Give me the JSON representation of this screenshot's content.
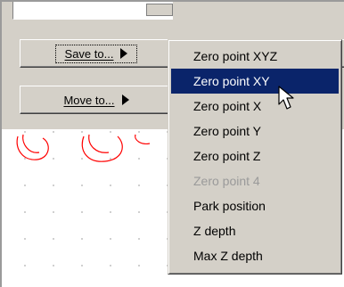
{
  "toolbar": {
    "save_button": {
      "label": "Save to...",
      "icon": "triangle-right-icon"
    },
    "move_button": {
      "label": "Move to...",
      "icon": "triangle-right-icon"
    }
  },
  "context_menu": {
    "items": [
      {
        "label": "Zero point XYZ",
        "state": "normal"
      },
      {
        "label": "Zero point XY",
        "state": "highlighted"
      },
      {
        "label": "Zero point X",
        "state": "normal"
      },
      {
        "label": "Zero point Y",
        "state": "normal"
      },
      {
        "label": "Zero point Z",
        "state": "normal"
      },
      {
        "label": "Zero point 4",
        "state": "disabled"
      },
      {
        "label": "Park position",
        "state": "normal"
      },
      {
        "label": "Z depth",
        "state": "normal"
      },
      {
        "label": "Max Z depth",
        "state": "normal"
      }
    ],
    "highlight_color": "#0a246a"
  },
  "canvas": {
    "curve_color": "#ff0000",
    "grid_dot_color": "#c9c9c9"
  },
  "cursor": {
    "icon": "arrow-pointer-icon"
  }
}
